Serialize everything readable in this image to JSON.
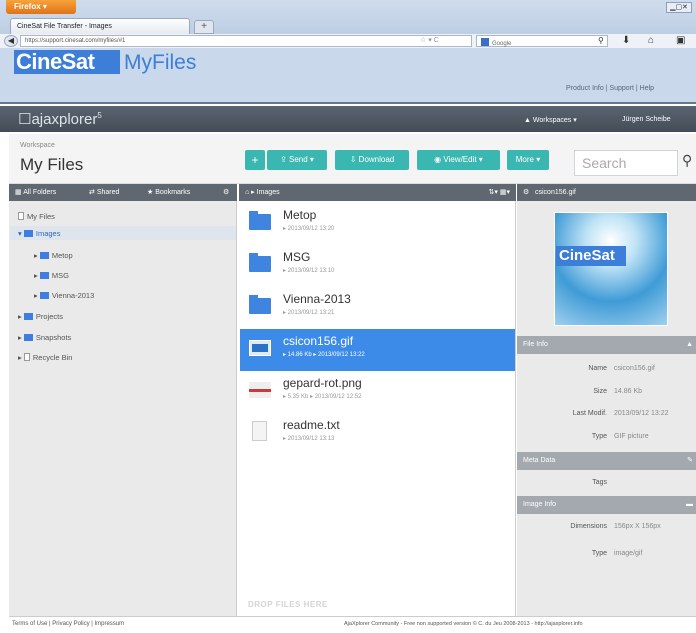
{
  "browser": {
    "menu_button": "Firefox ▾",
    "window_controls": "▁▢✕",
    "tab_title": "CineSat File Transfer - Images",
    "new_tab": "+",
    "url": "https://support.cinesat.com/myfiles/#1",
    "url_icons": "☆ ▾ C",
    "search_engine": "Google",
    "search_icon": "⚲",
    "download_icon": "⬇",
    "home_icon": "⌂",
    "menu_icon": "▣"
  },
  "header": {
    "brand_primary": "CineSat",
    "brand_secondary": "MyFiles",
    "top_links": "Product Info | Support | Help",
    "ajax_logo": "ajaxplorer",
    "ajax_version": "5",
    "workspaces_menu": "▲ Workspaces ▾",
    "user_menu": "Jürgen Scheibe"
  },
  "workspace": {
    "label": "Workspace",
    "name": "My Files"
  },
  "actions": {
    "add": "+",
    "send": "⇪ Send ▾",
    "download": "⇩ Download",
    "view_edit": "◉ View/Edit ▾",
    "more": "More ▾",
    "search_placeholder": "Search",
    "search_icon": "⚲"
  },
  "left_panel": {
    "tabs": [
      "All Folders",
      "Shared",
      "Bookmarks"
    ],
    "tab_icons": [
      "▦",
      "⇄",
      "★"
    ],
    "settings_icon": "⚙",
    "tree": [
      {
        "label": "My Files",
        "prefix": "▯"
      },
      {
        "label": "Images",
        "prefix": "▾"
      },
      {
        "label": "Metop",
        "prefix": "▸"
      },
      {
        "label": "MSG",
        "prefix": "▸"
      },
      {
        "label": "Vienna-2013",
        "prefix": "▸"
      },
      {
        "label": "Projects",
        "prefix": "▸"
      },
      {
        "label": "Snapshots",
        "prefix": "▸"
      },
      {
        "label": "Recycle Bin",
        "prefix": "▸"
      }
    ]
  },
  "mid_panel": {
    "breadcrumb": "⌂ ▸ Images",
    "view_controls": "⇅▾ ▦▾",
    "files": [
      {
        "name": "Metop",
        "meta": "▸ 2013/09/12 13:20",
        "type": "folder"
      },
      {
        "name": "MSG",
        "meta": "▸ 2013/09/12 13:10",
        "type": "folder"
      },
      {
        "name": "Vienna-2013",
        "meta": "▸ 2013/09/12 13:21",
        "type": "folder"
      },
      {
        "name": "csicon156.gif",
        "meta": "▸ 14.86 Kb ▸ 2013/09/12 13:22",
        "type": "image"
      },
      {
        "name": "gepard-rot.png",
        "meta": "▸ 5.35 Kb ▸ 2013/09/12 12:52",
        "type": "image-red"
      },
      {
        "name": "readme.txt",
        "meta": "▸ 2013/09/12 13:13",
        "type": "text"
      }
    ],
    "drop_hint": "DROP FILES HERE"
  },
  "right_panel": {
    "header_title": "csicon156.gif",
    "header_icon": "⚙",
    "preview_logo": "CineSat",
    "file_info_title": "File Info",
    "file_info": [
      {
        "key": "Name",
        "value": "csicon156.gif"
      },
      {
        "key": "Size",
        "value": "14.86 Kb"
      },
      {
        "key": "Last Modif.",
        "value": "2013/09/12 13:22"
      },
      {
        "key": "Type",
        "value": "GIF picture"
      }
    ],
    "meta_title": "Meta Data",
    "meta_data": [
      {
        "key": "Tags",
        "value": ""
      }
    ],
    "image_info_title": "Image Info",
    "image_info": [
      {
        "key": "Dimensions",
        "value": "156px X 156px"
      },
      {
        "key": "Type",
        "value": "image/gif"
      }
    ]
  },
  "footer": {
    "left": "Terms of Use | Privacy Policy | Impressum",
    "right": "AjaXplorer Community - Free non supported version © C. du Jeu 2008-2013 - http://ajaxplorer.info"
  },
  "colors": {
    "brand_blue": "#3c7ed8",
    "teal": "#3bb7b1",
    "selection": "#3d8be8",
    "header_dark": "#5f6870"
  }
}
